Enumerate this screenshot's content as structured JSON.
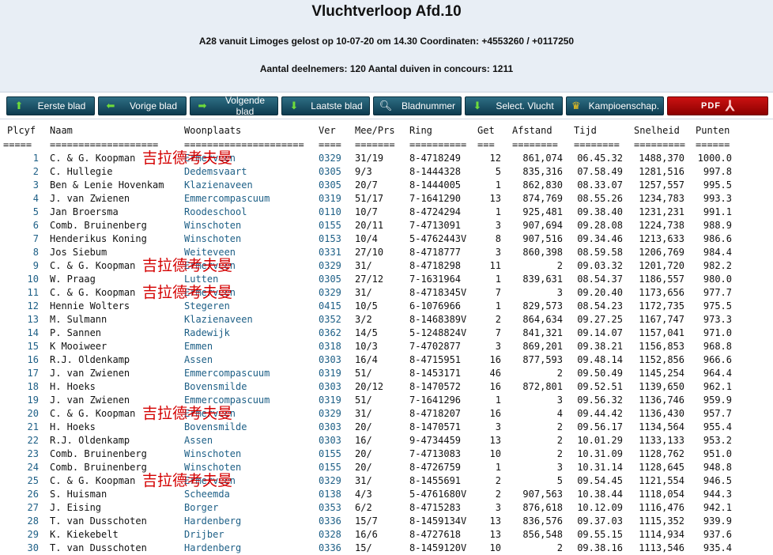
{
  "header": {
    "title": "Vluchtverloop Afd.10",
    "subtitle": "A28 vanuit Limoges gelost op 10-07-20 om 14.30 Coordinaten: +4553260 / +0117250",
    "info": "Aantal deelnemers: 120 Aantal duiven in concours: 1211"
  },
  "toolbar": [
    {
      "label": "Eerste blad",
      "icon": "arrow-up-icon"
    },
    {
      "label": "Vorige blad",
      "icon": "arrow-left-icon"
    },
    {
      "label": "Volgende blad",
      "icon": "arrow-right-icon"
    },
    {
      "label": "Laatste blad",
      "icon": "arrow-down-icon"
    },
    {
      "label": "Bladnummer",
      "icon": "magnifier-icon"
    },
    {
      "label": "Select. Vlucht",
      "icon": "select-icon"
    },
    {
      "label": "Kampioenschap.",
      "icon": "crown-icon"
    },
    {
      "label": "PDF",
      "icon": "pdf-icon"
    }
  ],
  "columns": [
    "Plcyf",
    "Naam",
    "Woonplaats",
    "Ver",
    "Mee/Prs",
    "Ring",
    "Get",
    "Afstand",
    "Tijd",
    "Snelheid",
    "Punten"
  ],
  "underlines": [
    "=====",
    "===================",
    "=====================",
    "====",
    "=======",
    "==========",
    "===",
    "========",
    "========",
    "=========",
    "======"
  ],
  "rows": [
    [
      "1",
      "C. & G. Koopman",
      "Ermerveen",
      "0329",
      "31/19",
      "8-4718249",
      "12",
      "861,074",
      "06.45.32",
      "1488,370",
      "1000.0"
    ],
    [
      "2",
      "C. Hullegie",
      "Dedemsvaart",
      "0305",
      "9/3",
      "8-1444328",
      "5",
      "835,316",
      "07.58.49",
      "1281,516",
      "997.8"
    ],
    [
      "3",
      "Ben & Lenie Hovenkam",
      "Klazienaveen",
      "0305",
      "20/7",
      "8-1444005",
      "1",
      "862,830",
      "08.33.07",
      "1257,557",
      "995.5"
    ],
    [
      "4",
      "J. van Zwienen",
      "Emmercompascuum",
      "0319",
      "51/17",
      "7-1641290",
      "13",
      "874,769",
      "08.55.26",
      "1234,783",
      "993.3"
    ],
    [
      "5",
      "Jan Broersma",
      "Roodeschool",
      "0110",
      "10/7",
      "8-4724294",
      "1",
      "925,481",
      "09.38.40",
      "1231,231",
      "991.1"
    ],
    [
      "6",
      "Comb. Bruinenberg",
      "Winschoten",
      "0155",
      "20/11",
      "7-4713091",
      "3",
      "907,694",
      "09.28.08",
      "1224,738",
      "988.9"
    ],
    [
      "7",
      "Henderikus Koning",
      "Winschoten",
      "0153",
      "10/4",
      "5-4762443V",
      "8",
      "907,516",
      "09.34.46",
      "1213,633",
      "986.6"
    ],
    [
      "8",
      "Jos Siebum",
      "Weiteveen",
      "0331",
      "27/10",
      "8-4718777",
      "3",
      "860,398",
      "08.59.58",
      "1206,769",
      "984.4"
    ],
    [
      "9",
      "C. & G. Koopman",
      "Ermerveen",
      "0329",
      "31/",
      "8-4718298",
      "11",
      "2",
      "09.03.32",
      "1201,720",
      "982.2"
    ],
    [
      "10",
      "W. Praag",
      "Lutten",
      "0305",
      "27/12",
      "7-1631964",
      "1",
      "839,631",
      "08.54.37",
      "1186,557",
      "980.0"
    ],
    [
      "11",
      "C. & G. Koopman",
      "Ermerveen",
      "0329",
      "31/",
      "8-4718345V",
      "7",
      "3",
      "09.20.40",
      "1173,656",
      "977.7"
    ],
    [
      "12",
      "Hennie Wolters",
      "Stegeren",
      "0415",
      "10/5",
      "6-1076966",
      "1",
      "829,573",
      "08.54.23",
      "1172,735",
      "975.5"
    ],
    [
      "13",
      "M. Sulmann",
      "Klazienaveen",
      "0352",
      "3/2",
      "8-1468389V",
      "2",
      "864,634",
      "09.27.25",
      "1167,747",
      "973.3"
    ],
    [
      "14",
      "P. Sannen",
      "Radewijk",
      "0362",
      "14/5",
      "5-1248824V",
      "7",
      "841,321",
      "09.14.07",
      "1157,041",
      "971.0"
    ],
    [
      "15",
      "K Mooiweer",
      "Emmen",
      "0318",
      "10/3",
      "7-4702877",
      "3",
      "869,201",
      "09.38.21",
      "1156,853",
      "968.8"
    ],
    [
      "16",
      "R.J. Oldenkamp",
      "Assen",
      "0303",
      "16/4",
      "8-4715951",
      "16",
      "877,593",
      "09.48.14",
      "1152,856",
      "966.6"
    ],
    [
      "17",
      "J. van Zwienen",
      "Emmercompascuum",
      "0319",
      "51/",
      "8-1453171",
      "46",
      "2",
      "09.50.49",
      "1145,254",
      "964.4"
    ],
    [
      "18",
      "H. Hoeks",
      "Bovensmilde",
      "0303",
      "20/12",
      "8-1470572",
      "16",
      "872,801",
      "09.52.51",
      "1139,650",
      "962.1"
    ],
    [
      "19",
      "J. van Zwienen",
      "Emmercompascuum",
      "0319",
      "51/",
      "7-1641296",
      "1",
      "3",
      "09.56.32",
      "1136,746",
      "959.9"
    ],
    [
      "20",
      "C. & G. Koopman",
      "Ermerveen",
      "0329",
      "31/",
      "8-4718207",
      "16",
      "4",
      "09.44.42",
      "1136,430",
      "957.7"
    ],
    [
      "21",
      "H. Hoeks",
      "Bovensmilde",
      "0303",
      "20/",
      "8-1470571",
      "3",
      "2",
      "09.56.17",
      "1134,564",
      "955.4"
    ],
    [
      "22",
      "R.J. Oldenkamp",
      "Assen",
      "0303",
      "16/",
      "9-4734459",
      "13",
      "2",
      "10.01.29",
      "1133,133",
      "953.2"
    ],
    [
      "23",
      "Comb. Bruinenberg",
      "Winschoten",
      "0155",
      "20/",
      "7-4713083",
      "10",
      "2",
      "10.31.09",
      "1128,762",
      "951.0"
    ],
    [
      "24",
      "Comb. Bruinenberg",
      "Winschoten",
      "0155",
      "20/",
      "8-4726759",
      "1",
      "3",
      "10.31.14",
      "1128,645",
      "948.8"
    ],
    [
      "25",
      "C. & G. Koopman",
      "Ermerveen",
      "0329",
      "31/",
      "8-1455691",
      "2",
      "5",
      "09.54.45",
      "1121,554",
      "946.5"
    ],
    [
      "26",
      "S. Huisman",
      "Scheemda",
      "0138",
      "4/3",
      "5-4761680V",
      "2",
      "907,563",
      "10.38.44",
      "1118,054",
      "944.3"
    ],
    [
      "27",
      "J. Eising",
      "Borger",
      "0353",
      "6/2",
      "8-4715283",
      "3",
      "876,618",
      "10.12.09",
      "1116,476",
      "942.1"
    ],
    [
      "28",
      "T. van Dusschoten",
      "Hardenberg",
      "0336",
      "15/7",
      "8-1459134V",
      "13",
      "836,576",
      "09.37.03",
      "1115,352",
      "939.9"
    ],
    [
      "29",
      "K. Kiekebelt",
      "Drijber",
      "0328",
      "16/6",
      "8-4727618",
      "13",
      "856,548",
      "09.55.15",
      "1114,934",
      "937.6"
    ],
    [
      "30",
      "T. van Dusschoten",
      "Hardenberg",
      "0336",
      "15/",
      "8-1459120V",
      "10",
      "2",
      "09.38.16",
      "1113,546",
      "935.4"
    ]
  ],
  "overlays": [
    {
      "text": "吉拉德考夫曼",
      "row": 1
    },
    {
      "text": "吉拉德考夫曼",
      "row": 9
    },
    {
      "text": "吉拉德考夫曼",
      "row": 11
    },
    {
      "text": "吉拉德考夫曼",
      "row": 20
    },
    {
      "text": "吉拉德考夫曼",
      "row": 25
    }
  ]
}
